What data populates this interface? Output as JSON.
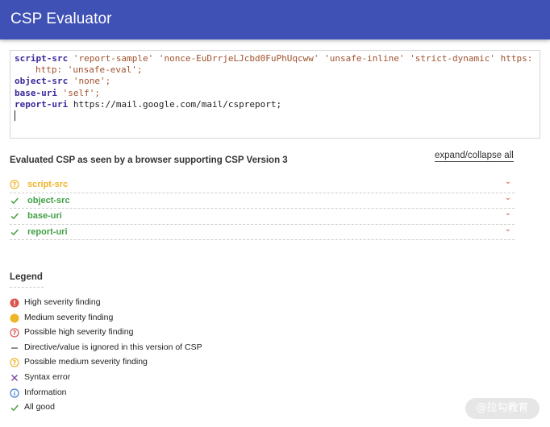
{
  "app": {
    "title": "CSP Evaluator",
    "accent": "#3f51b5"
  },
  "editor": {
    "lines": [
      {
        "keyword": "script-src",
        "values": "'report-sample' 'nonce-EuDrrjeLJcbd0FuPhUqcww' 'unsafe-inline' 'strict-dynamic' https:"
      },
      {
        "keyword": "",
        "values": "http: 'unsafe-eval';"
      },
      {
        "keyword": "object-src",
        "values": "'none';"
      },
      {
        "keyword": "base-uri",
        "values": "'self';"
      },
      {
        "keyword": "report-uri",
        "values": "https://mail.google.com/mail/cspreport;"
      }
    ]
  },
  "evaluation": {
    "heading": "Evaluated CSP as seen by a browser supporting CSP Version 3",
    "expand_label": "expand/collapse all",
    "directives": [
      {
        "name": "script-src",
        "status": "possible-medium",
        "icon": "question-circle-icon",
        "color": "#f0b429"
      },
      {
        "name": "object-src",
        "status": "ok",
        "icon": "check-icon",
        "color": "#43a047"
      },
      {
        "name": "base-uri",
        "status": "ok",
        "icon": "check-icon",
        "color": "#43a047"
      },
      {
        "name": "report-uri",
        "status": "ok",
        "icon": "check-icon",
        "color": "#43a047"
      }
    ],
    "chevron_color": "#d9534f"
  },
  "legend": {
    "title": "Legend",
    "items": [
      {
        "label": "High severity finding",
        "icon": "high-severity-icon",
        "color": "#d9534f"
      },
      {
        "label": "Medium severity finding",
        "icon": "medium-severity-icon",
        "color": "#f0b429"
      },
      {
        "label": "Possible high severity finding",
        "icon": "possible-high-icon",
        "color": "#d9534f"
      },
      {
        "label": "Directive/value is ignored in this version of CSP",
        "icon": "ignored-dash-icon",
        "color": "#555555"
      },
      {
        "label": "Possible medium severity finding",
        "icon": "possible-medium-icon",
        "color": "#f0b429"
      },
      {
        "label": "Syntax error",
        "icon": "syntax-error-x-icon",
        "color": "#7b3fa0"
      },
      {
        "label": "Information",
        "icon": "info-icon",
        "color": "#3f7fd0"
      },
      {
        "label": "All good",
        "icon": "check-icon",
        "color": "#43a047"
      }
    ]
  },
  "watermark": "@拉勾教育"
}
